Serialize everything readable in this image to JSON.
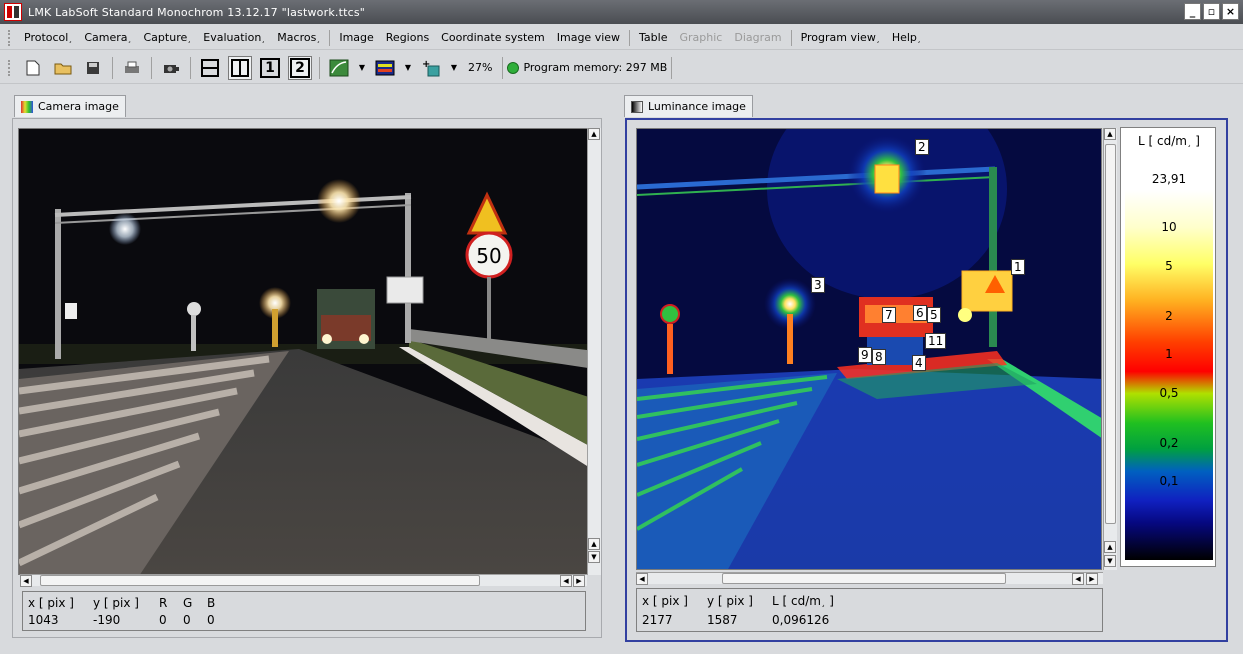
{
  "window": {
    "title": "LMK LabSoft Standard Monochrom  13.12.17 \"lastwork.ttcs\"",
    "buttons": [
      "_",
      "▫",
      "×"
    ]
  },
  "menu": {
    "items": [
      {
        "label": "Protocol",
        "disabled": false
      },
      {
        "label": "Camera",
        "disabled": false
      },
      {
        "label": "Capture",
        "disabled": false
      },
      {
        "label": "Evaluation",
        "disabled": false
      },
      {
        "label": "Macros",
        "disabled": false
      },
      {
        "label": "Image",
        "disabled": false
      },
      {
        "label": "Regions",
        "disabled": false
      },
      {
        "label": "Coordinate system",
        "disabled": false
      },
      {
        "label": "Image view",
        "disabled": false
      },
      {
        "label": "Table",
        "disabled": false
      },
      {
        "label": "Graphic",
        "disabled": true
      },
      {
        "label": "Diagram",
        "disabled": true
      },
      {
        "label": "Program view",
        "disabled": false
      },
      {
        "label": "Help",
        "disabled": false
      }
    ]
  },
  "toolbar": {
    "zoom": "27%",
    "memory": "Program memory: 297 MB",
    "view1": "1",
    "view2": "2"
  },
  "left_panel": {
    "tab": "Camera image",
    "info": {
      "headers": [
        "x [ pix ]",
        "y [ pix ]",
        "R",
        "G",
        "B"
      ],
      "values": [
        "1043",
        "-190",
        "0",
        "0",
        "0"
      ]
    },
    "sign_value": "50"
  },
  "right_panel": {
    "tab": "Luminance image",
    "info": {
      "headers": [
        "x [ pix ]",
        "y [ pix ]",
        "L [ cd/m",
        "]"
      ],
      "values": [
        "2177",
        "1587",
        "0,096126"
      ]
    },
    "regions": [
      "1",
      "2",
      "3",
      "4",
      "5",
      "6",
      "7",
      "8",
      "9",
      "11"
    ]
  },
  "legend": {
    "title": "L [ cd/m",
    "max": "23,91",
    "ticks": [
      "10",
      "5",
      "2",
      "1",
      "0,5",
      "0,2",
      "0,1"
    ]
  }
}
